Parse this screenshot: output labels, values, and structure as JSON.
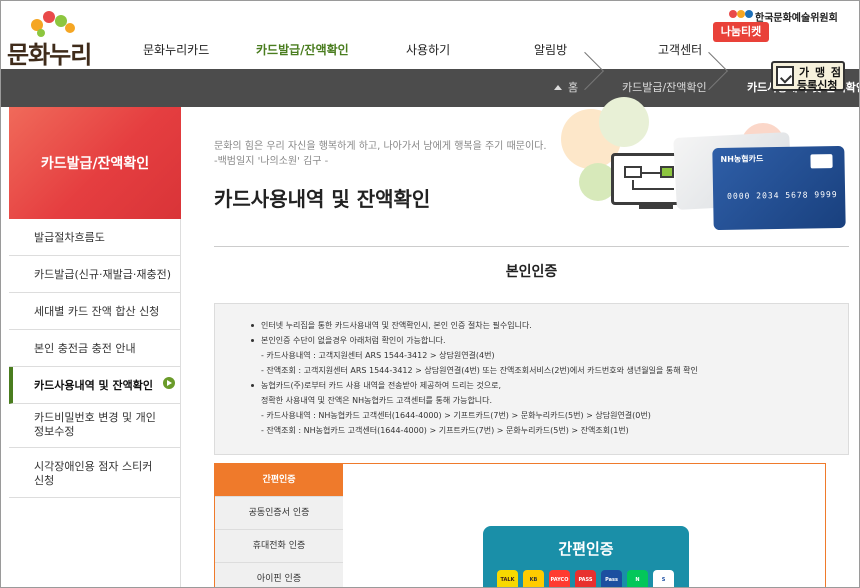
{
  "brand": {
    "logo_text": "문화누리",
    "arts_council": "한국문화예술위원회",
    "nanum_ticket": "나눔티켓"
  },
  "gnb": [
    "문화누리카드",
    "카드발급/잔액확인",
    "사용하기",
    "알림방",
    "고객센터"
  ],
  "gnb_active": "카드발급/잔액확인",
  "breadcrumb": {
    "home": "홈",
    "level1": "카드발급/잔액확인",
    "level2": "카드사용내역 및 잔액확인"
  },
  "franchise_badge": {
    "line1": "가 맹 점",
    "line2": "등록신청"
  },
  "sidebar": {
    "title": "카드발급/잔액확인",
    "items": [
      {
        "label": "발급절차흐름도",
        "active": false
      },
      {
        "label": "카드발급(신규·재발급·재충전)",
        "active": false
      },
      {
        "label": "세대별 카드 잔액 합산 신청",
        "active": false
      },
      {
        "label": "본인 충전금 충전 안내",
        "active": false
      },
      {
        "label": "카드사용내역 및 잔액확인",
        "active": true
      },
      {
        "label": "카드비밀번호 변경 및 개인",
        "label2": "정보수정",
        "active": false
      },
      {
        "label": "시각장애인용 점자 스티커",
        "label2": "신청",
        "active": false
      }
    ]
  },
  "hero": {
    "quote_line1": "문화의 힘은 우리 자신을 행복하게 하고, 나아가서 남에게 행복을 주기 때문이다.",
    "quote_line2": "-백범일지 '나의소원' 김구 -",
    "title": "카드사용내역 및 잔액확인",
    "card_brand": "NH농협카드",
    "card_number": "0000 2034 5678 9999"
  },
  "auth_heading": "본인인증",
  "notice": [
    {
      "text": "인터넷 누리집을 통한 카드사용내역 및 잔액확인시, 본인 인증 절차는 필수입니다.",
      "bullet": true
    },
    {
      "text": "본인인증 수단이 없을경우 아래처럼 확인이 가능합니다.",
      "bullet": true
    },
    {
      "text": "- 카드사용내역 : 고객지원센터 ARS 1544-3412 > 상담원연결(4번)",
      "bullet": false
    },
    {
      "text": "- 잔액조회 : 고객지원센터 ARS 1544-3412 > 상담원연결(4번) 또는 잔액조회서비스(2번)에서 카드번호와 생년월일을 통해 확인",
      "bullet": false
    },
    {
      "text": "농협카드(주)로부터 카드 사용 내역을 전송받아 제공하여 드리는 것으로,",
      "bullet": true
    },
    {
      "text": "정확한 사용내역 및 잔액은 NH농협카드 고객센터를 통해 가능합니다.",
      "bullet": false
    },
    {
      "text": "- 카드사용내역 : NH농협카드 고객센터(1644-4000) > 기프트카드(7번) > 문화누리카드(5번) > 상담원연결(0번)",
      "bullet": false
    },
    {
      "text": "- 잔액조회 : NH농협카드 고객센터(1644-4000) > 기프트카드(7번) > 문화누리카드(5번) > 잔액조회(1번)",
      "bullet": false
    }
  ],
  "tabs": [
    {
      "label": "간편인증",
      "active": true
    },
    {
      "label": "공동인증서 인증",
      "active": false
    },
    {
      "label": "휴대전화 인증",
      "active": false
    },
    {
      "label": "아이핀 인증",
      "active": false
    }
  ],
  "easy_auth": {
    "title": "간편인증",
    "apps": [
      {
        "label": "TALK",
        "color": "#f7d900",
        "text_color": "#3a1d1d"
      },
      {
        "label": "KB",
        "color": "#ffcc00",
        "text_color": "#333333"
      },
      {
        "label": "PAYCO",
        "color": "#ff3b30",
        "text_color": "#ffffff"
      },
      {
        "label": "PASS",
        "color": "#e8302e",
        "text_color": "#ffffff"
      },
      {
        "label": "Pass",
        "color": "#1c4fa0",
        "text_color": "#ffffff"
      },
      {
        "label": "N",
        "color": "#03c75a",
        "text_color": "#ffffff"
      },
      {
        "label": "S",
        "color": "#ffffff",
        "text_color": "#1d4ea3"
      }
    ]
  },
  "colors": {
    "accent_red": "#e94a4a",
    "accent_green": "#4a7d1f",
    "tab_orange": "#ef7a2b",
    "nav_gray": "#4c4c4c"
  }
}
